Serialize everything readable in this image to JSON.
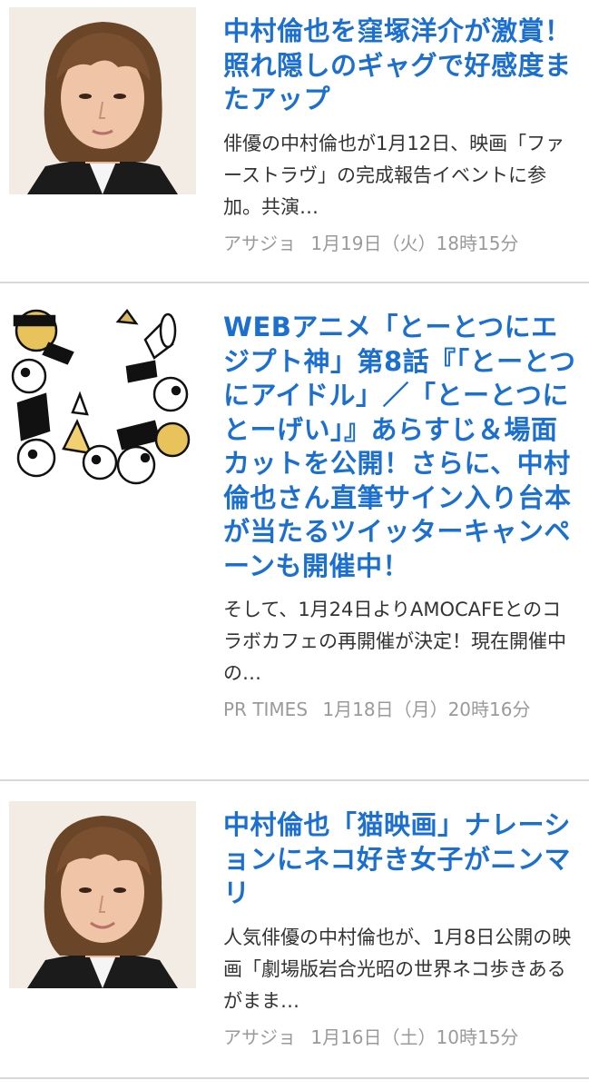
{
  "articles": [
    {
      "title": "中村倫也を窪塚洋介が激賞！照れ隠しのギャグで好感度またアップ",
      "snippet": "俳優の中村倫也が1月12日、映画「ファーストラヴ」の完成報告イベントに参加。共演…",
      "source": "アサジョ",
      "date": "1月19日（火）18時15分",
      "thumbnail": "portrait-photo"
    },
    {
      "title": "WEBアニメ「とーとつにエジプト神」第8話『「とーとつにアイドル」／「とーとつにとーげい」』あらすじ＆場面カットを公開！さらに、中村倫也さん直筆サイン入り台本が当たるツイッターキャンペーンも開催中！",
      "snippet": "そして、1月24日よりAMOCAFEとのコラボカフェの再開催が決定！現在開催中の…",
      "source": "PR TIMES",
      "date": "1月18日（月）20時16分",
      "thumbnail": "anime-illustration"
    },
    {
      "title": "中村倫也「猫映画」ナレーションにネコ好き女子がニンマリ",
      "snippet": "人気俳優の中村倫也が、1月8日公開の映画「劇場版岩合光昭の世界ネコ歩きあるがまま…",
      "source": "アサジョ",
      "date": "1月16日（土）10時15分",
      "thumbnail": "portrait-photo"
    }
  ],
  "colors": {
    "title": "#1a6fd1",
    "snippet": "#333333",
    "meta": "#9a9a9a",
    "divider": "#d8d8d8"
  }
}
